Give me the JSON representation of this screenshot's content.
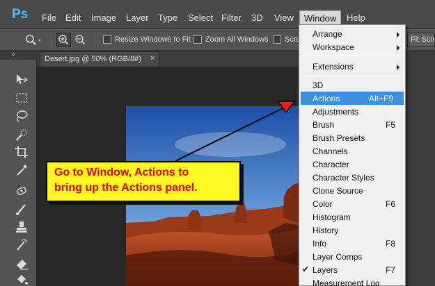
{
  "app": {
    "logo": "Ps"
  },
  "menubar": {
    "items": [
      "File",
      "Edit",
      "Image",
      "Layer",
      "Type",
      "Select",
      "Filter",
      "3D",
      "View",
      "Window",
      "Help"
    ],
    "active": "Window"
  },
  "options": {
    "resize_windows": "Resize Windows to Fit",
    "zoom_all": "Zoom All Windows",
    "scrubby": "Scru",
    "fit_screen": "Fit Scre"
  },
  "document": {
    "tab_title": "Desert.jpg @ 50% (RGB/8#)",
    "close_glyph": "×"
  },
  "callout": {
    "line1": "Go to Window, Actions to",
    "line2": "bring up the Actions panel."
  },
  "window_menu": {
    "items": [
      {
        "label": "Arrange",
        "submenu": true
      },
      {
        "label": "Workspace",
        "submenu": true
      },
      {
        "label": "Extensions",
        "submenu": true
      },
      {
        "label": "3D"
      },
      {
        "label": "Actions",
        "shortcut": "Alt+F9",
        "highlighted": true
      },
      {
        "label": "Adjustments"
      },
      {
        "label": "Brush",
        "shortcut": "F5"
      },
      {
        "label": "Brush Presets"
      },
      {
        "label": "Channels"
      },
      {
        "label": "Character"
      },
      {
        "label": "Character Styles"
      },
      {
        "label": "Clone Source"
      },
      {
        "label": "Color",
        "shortcut": "F6"
      },
      {
        "label": "Histogram"
      },
      {
        "label": "History"
      },
      {
        "label": "Info",
        "shortcut": "F8"
      },
      {
        "label": "Layer Comps"
      },
      {
        "label": "Layers",
        "shortcut": "F7",
        "checked": true
      },
      {
        "label": "Measurement Log"
      }
    ],
    "check_glyph": "✔"
  },
  "colors": {
    "accent": "#3b8fdc",
    "callout_bg": "#fff722",
    "callout_text": "#e60000",
    "arrow_head": "#ff0000"
  }
}
